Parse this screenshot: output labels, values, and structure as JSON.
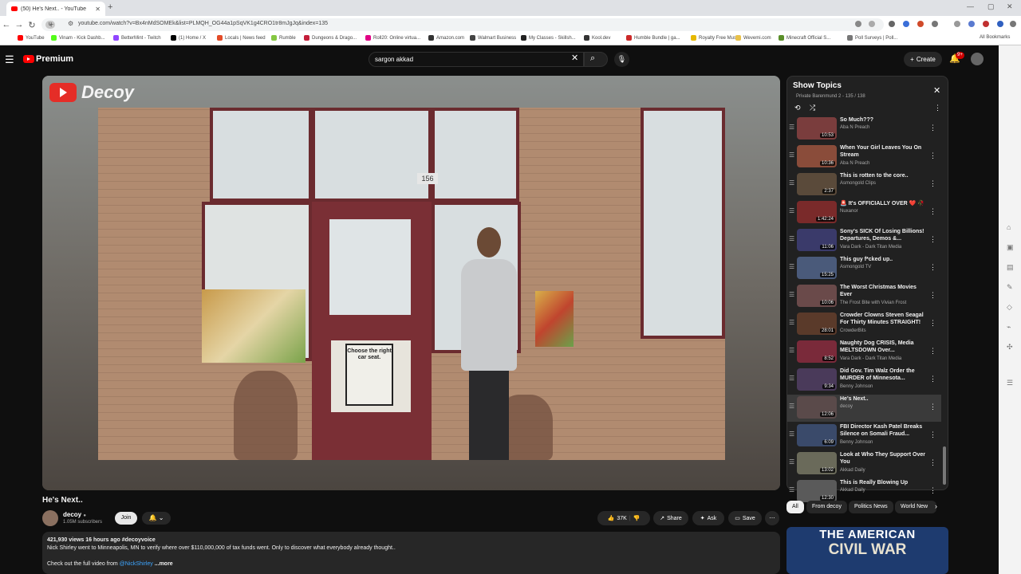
{
  "browser": {
    "tab_title": "(50) He's Next.. - YouTube",
    "url": "youtube.com/watch?v=Bx4nMdSOMEk&list=PLMQH_OG44a1pSqVK1g4CRO1tr8mJgJq&index=135",
    "url_chip": "ɥ̶",
    "bookmarks": [
      {
        "label": "YouTube",
        "color": "#ff0000"
      },
      {
        "label": "Vinam - Kick Dashb...",
        "color": "#53fc18"
      },
      {
        "label": "BetterMint - Twitch",
        "color": "#9146ff"
      },
      {
        "label": "(1) Home / X",
        "color": "#000000"
      },
      {
        "label": "Locals | News feed",
        "color": "#e34b27"
      },
      {
        "label": "Rumble",
        "color": "#85c742"
      },
      {
        "label": "Dungeons & Drago...",
        "color": "#c41e3a"
      },
      {
        "label": "Roll20: Online virtua...",
        "color": "#e10085"
      },
      {
        "label": "Amazon.com",
        "color": "#333333"
      },
      {
        "label": "Walmart Business",
        "color": "#444444"
      },
      {
        "label": "My Classes - Skillsh...",
        "color": "#222222"
      },
      {
        "label": "Kool.dev",
        "color": "#333333"
      },
      {
        "label": "Humble Bundle | ga...",
        "color": "#cc2929"
      },
      {
        "label": "Royalty Free Music",
        "color": "#e6b800"
      },
      {
        "label": "Wevemi.com",
        "color": "#e8c14a"
      },
      {
        "label": "Minecraft Official S...",
        "color": "#5a8f29"
      },
      {
        "label": "Poll Surveys | Poll...",
        "color": "#777777"
      }
    ],
    "all_bookmarks": "All Bookmarks"
  },
  "header": {
    "logo": "Premium",
    "search_value": "sargon akkad",
    "create_label": "Create",
    "notif_count": "9+"
  },
  "video": {
    "overlay_brand": "Decoy",
    "address_number": "156",
    "sign_text": "Choose the right car seat.",
    "title": "He's Next..",
    "channel": "decoy",
    "subscribers": "1.05M subscribers",
    "join": "Join",
    "likes": "37K",
    "share": "Share",
    "ask": "Ask",
    "save": "Save",
    "stats": "421,930 views  16 hours ago  #decoyvoice",
    "desc_line": "Nick Shirley went to Minneapolis, MN to verify where over $110,000,000 of tax funds went. Only to discover what everybody already thought..",
    "desc_line2_prefix": "Check out the full video from ",
    "desc_link": "@NickShirley",
    "more": "...more"
  },
  "playlist": {
    "title": "Show Topics",
    "subtitle": "Private  Barenmund 2 - 135 / 138",
    "items": [
      {
        "title": "So Much???",
        "channel": "Aba N Preach",
        "duration": "10:53",
        "thumb": "#7a3d3d"
      },
      {
        "title": "When Your Girl Leaves You On Stream",
        "channel": "Aba N Preach",
        "duration": "10:36",
        "thumb": "#8a4c3a"
      },
      {
        "title": "This is rotten to the core..",
        "channel": "Asmongold Clips",
        "duration": "2:37",
        "thumb": "#5a4a3a"
      },
      {
        "title": "🚨 It's OFFICIALLY OVER ❤️ 🥀",
        "channel": "Nuxanor",
        "duration": "1:42:24",
        "thumb": "#7a2a2a"
      },
      {
        "title": "Sony's SICK Of Losing Billions! Departures, Demos &...",
        "channel": "Vara Dark - Dark Titan Media",
        "duration": "11:06",
        "thumb": "#3a3a6a"
      },
      {
        "title": "This guy f*cked up..",
        "channel": "Asmongold TV",
        "duration": "15:25",
        "thumb": "#4a5a7a"
      },
      {
        "title": "The Worst Christmas Movies Ever",
        "channel": "The Frost Bite with Vivian Frost",
        "duration": "10:06",
        "thumb": "#6a4a4a"
      },
      {
        "title": "Crowder Clowns Steven Seagal For Thirty Minutes STRAIGHT!",
        "channel": "CrowderBits",
        "duration": "28:01",
        "thumb": "#5a3a2a"
      },
      {
        "title": "Naughty Dog CRISIS, Media MELTSDOWN Over...",
        "channel": "Vara Dark - Dark Titan Media",
        "duration": "8:52",
        "thumb": "#7a2a3a"
      },
      {
        "title": "Did Gov. Tim Walz Order the MURDER of Minnesota...",
        "channel": "Benny Johnson",
        "duration": "9:34",
        "thumb": "#4a3a5a"
      },
      {
        "title": "He's Next..",
        "channel": "decoy",
        "duration": "12:06",
        "thumb": "#5a4a4a"
      },
      {
        "title": "FBI Director Kash Patel Breaks Silence on Somali Fraud...",
        "channel": "Benny Johnson",
        "duration": "6:09",
        "thumb": "#3a4a6a"
      },
      {
        "title": "Look at Who They Support Over You",
        "channel": "Akkad Daily",
        "duration": "13:02",
        "thumb": "#6a6a5a"
      },
      {
        "title": "This is Really Blowing Up",
        "channel": "Akkad Daily",
        "duration": "12:30",
        "thumb": "#5a5a5a"
      }
    ],
    "active_index": 10
  },
  "chips": [
    "All",
    "From decoy",
    "Politics News",
    "World New"
  ],
  "ad": {
    "line1": "THE AMERICAN",
    "line2": "CIVIL WAR"
  }
}
